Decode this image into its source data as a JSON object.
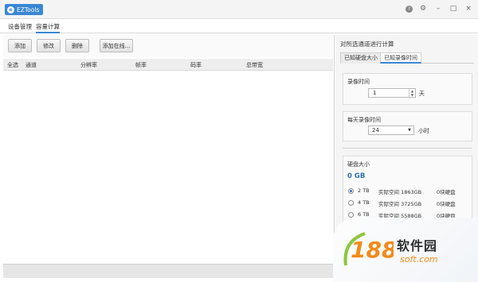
{
  "titlebar": {
    "app_name": "EZTools",
    "help_glyph": "?",
    "settings_glyph": "⚙",
    "minimize_glyph": "–",
    "maximize_glyph": "□",
    "close_glyph": "×"
  },
  "menu": {
    "items": [
      "设备管理",
      "容量计算"
    ],
    "active_index": 1
  },
  "toolbar": {
    "add_label": "添加",
    "edit_label": "修改",
    "delete_label": "删除",
    "add_online_label": "添加在线..."
  },
  "table": {
    "columns": [
      "全选",
      "通道",
      "分辨率",
      "帧率",
      "码率",
      "总带宽"
    ],
    "rows": []
  },
  "calc_panel": {
    "title": "对所选通道进行计算",
    "tabs": [
      "已知硬盘大小",
      "已知录像时间"
    ],
    "active_tab": 1,
    "record_time_label": "录像时间",
    "record_days_value": "1",
    "record_days_unit": "天",
    "daily_hours_label": "每天录像时间",
    "daily_hours_value": "24",
    "daily_hours_unit": "小时",
    "disk_size_label": "硬盘大小",
    "disk_size_value": "0 GB",
    "disk_options": [
      {
        "size": "2 TB",
        "space": "实际空间 1863GB",
        "count": "0块硬盘",
        "selected": true
      },
      {
        "size": "4 TB",
        "space": "实际空间 3725GB",
        "count": "0块硬盘",
        "selected": false
      },
      {
        "size": "6 TB",
        "space": "实际空间 5588GB",
        "count": "0块硬盘",
        "selected": false
      }
    ]
  },
  "watermark": {
    "logo_text": "188",
    "name": "软件园",
    "url": "soft.com"
  },
  "colors": {
    "accent": "#3a87d4",
    "gb_value": "#2f6fb3",
    "watermark_orange": "#f28a1c",
    "watermark_green": "#8cc63f"
  }
}
